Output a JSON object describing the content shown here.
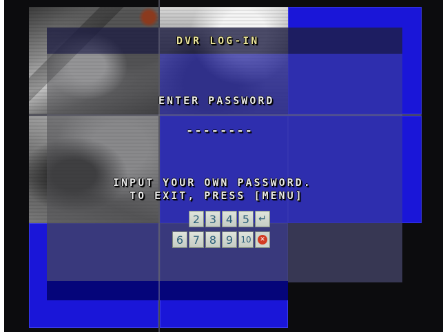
{
  "screen": {
    "title": "DVR LOG-IN",
    "password_label": "ENTER PASSWORD",
    "password_value": "--------",
    "instruction_line1": "INPUT YOUR OWN PASSWORD.",
    "instruction_line2": "TO EXIT, PRESS [MENU]"
  },
  "keypad": {
    "row1": [
      "2",
      "3",
      "4",
      "5"
    ],
    "row2": [
      "6",
      "7",
      "8",
      "9",
      "10"
    ],
    "enter_icon": "enter-arrow-icon",
    "cancel_icon": "cancel-icon"
  },
  "colors": {
    "osd_blue": "#1a16d8",
    "title_text": "#e8e29a",
    "keypad_digit": "#2b5f7a",
    "cancel_red": "#d23a22"
  }
}
